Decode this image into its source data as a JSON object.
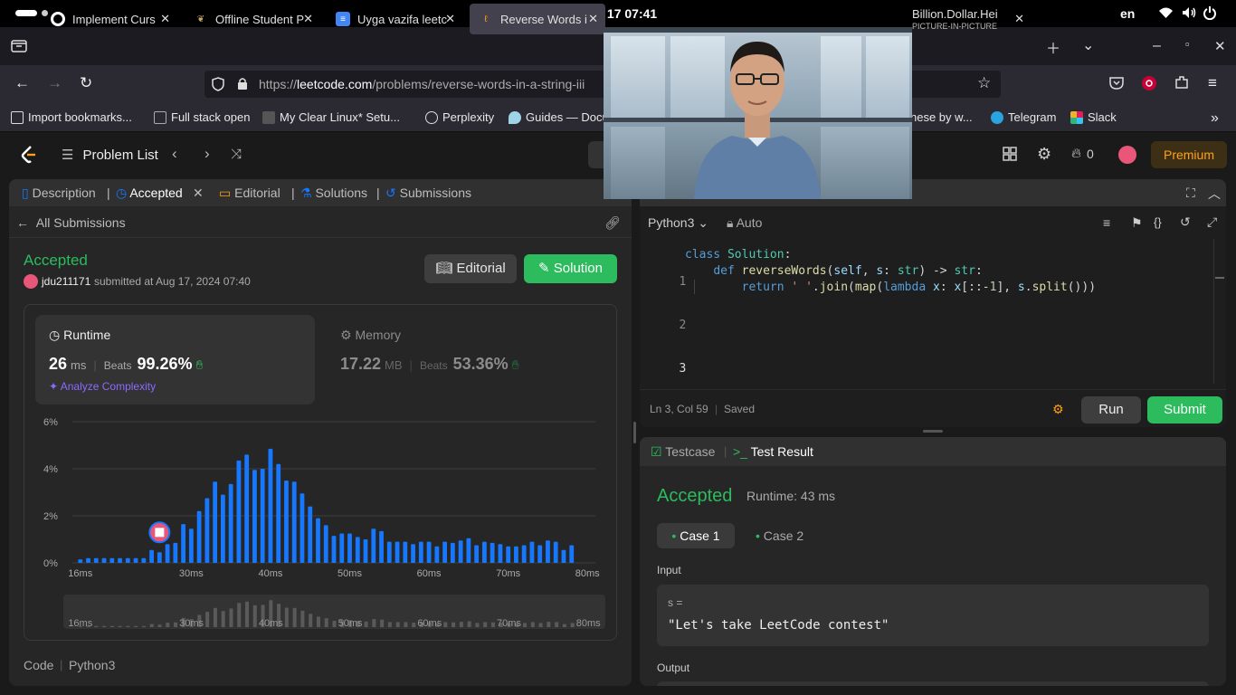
{
  "system": {
    "clock": "Aug 17  07:41",
    "lang": "en"
  },
  "browser": {
    "tabs": [
      {
        "title": "Implement Curs",
        "icon": "github-icon"
      },
      {
        "title": "Offline Student P",
        "icon": "bird-icon"
      },
      {
        "title": "Uyga vazifa leetc",
        "icon": "docs-icon"
      },
      {
        "title": "Reverse Words i",
        "icon": "leetcode-icon",
        "active": true
      },
      {
        "title": "Billion.Dollar.Hei",
        "subtitle": "PICTURE-IN-PICTURE",
        "icon": "pip-icon"
      }
    ],
    "url_prefix": "https://",
    "url_domain": "leetcode.com",
    "url_path": "/problems/reverse-words-in-a-string-iii",
    "bookmarks": [
      {
        "label": "Import bookmarks...",
        "icon": "import-icon"
      },
      {
        "label": "Full stack open",
        "icon": "page-icon"
      },
      {
        "label": "My Clear Linux* Setu...",
        "icon": "linux-icon"
      },
      {
        "label": "Perplexity",
        "icon": "globe-icon"
      },
      {
        "label": "Guides — Docu",
        "icon": "drop-icon"
      },
      {
        "label": "hese by w...",
        "icon": "page-icon"
      },
      {
        "label": "Telegram",
        "icon": "telegram-icon"
      },
      {
        "label": "Slack",
        "icon": "slack-icon"
      }
    ]
  },
  "leetcode": {
    "problem_list": "Problem List",
    "streak": "0",
    "premium": "Premium"
  },
  "left_panel": {
    "tabs": {
      "description": "Description",
      "accepted": "Accepted",
      "editorial": "Editorial",
      "solutions": "Solutions",
      "submissions": "Submissions"
    },
    "back_label": "All Submissions",
    "status": "Accepted",
    "user": "jdu211171",
    "submitted": "submitted at Aug 17, 2024 07:40",
    "editorial_btn": "Editorial",
    "solution_btn": "Solution",
    "runtime": {
      "label": "Runtime",
      "value": "26",
      "unit": "ms",
      "beats_label": "Beats",
      "beats": "99.26%",
      "analyze": "Analyze Complexity"
    },
    "memory": {
      "label": "Memory",
      "value": "17.22",
      "unit": "MB",
      "beats_label": "Beats",
      "beats": "53.36%"
    },
    "code_label": "Code",
    "code_lang": "Python3"
  },
  "chart_data": {
    "type": "bar",
    "title": "",
    "xlabel": "",
    "ylabel": "",
    "y_ticks": [
      "6%",
      "4%",
      "2%",
      "0%"
    ],
    "ylim": [
      0,
      6
    ],
    "x_ticks": [
      "16ms",
      "30ms",
      "40ms",
      "50ms",
      "60ms",
      "70ms",
      "80ms"
    ],
    "x_tick_values": [
      16,
      30,
      40,
      50,
      60,
      70,
      80
    ],
    "xlim": [
      15,
      81
    ],
    "x": [
      16,
      17,
      18,
      19,
      20,
      21,
      22,
      23,
      24,
      25,
      26,
      27,
      28,
      29,
      30,
      31,
      32,
      33,
      34,
      35,
      36,
      37,
      38,
      39,
      40,
      41,
      42,
      43,
      44,
      45,
      46,
      47,
      48,
      49,
      50,
      51,
      52,
      53,
      54,
      55,
      56,
      57,
      58,
      59,
      60,
      61,
      62,
      63,
      64,
      65,
      66,
      67,
      68,
      69,
      70,
      71,
      72,
      73,
      74,
      75,
      76,
      77,
      78,
      79,
      80
    ],
    "values": [
      0.15,
      0.2,
      0.2,
      0.2,
      0.2,
      0.2,
      0.2,
      0.2,
      0.2,
      0.55,
      0.45,
      0.8,
      0.85,
      1.65,
      1.45,
      2.2,
      2.75,
      3.45,
      2.9,
      3.35,
      4.35,
      4.6,
      3.95,
      4.0,
      4.85,
      4.2,
      3.5,
      3.45,
      2.95,
      2.4,
      1.9,
      1.6,
      1.15,
      1.25,
      1.25,
      1.1,
      1.0,
      1.45,
      1.35,
      0.9,
      0.9,
      0.9,
      0.8,
      0.9,
      0.9,
      0.7,
      0.9,
      0.85,
      0.95,
      1.05,
      0.75,
      0.9,
      0.85,
      0.8,
      0.7,
      0.7,
      0.75,
      0.9,
      0.75,
      0.95,
      0.9,
      0.55,
      0.75
    ],
    "user_marker_x": 26,
    "bar_color": "#1677ff",
    "grid": true
  },
  "editor": {
    "language": "Python3",
    "mode": "Auto",
    "line_numbers": [
      "1",
      "2",
      "3"
    ],
    "status_pos": "Ln 3, Col 59",
    "status_saved": "Saved",
    "run": "Run",
    "submit": "Submit"
  },
  "result": {
    "tab_testcase": "Testcase",
    "tab_result": "Test Result",
    "status": "Accepted",
    "runtime": "Runtime: 43 ms",
    "cases": [
      "Case 1",
      "Case 2"
    ],
    "input_label": "Input",
    "var_label": "s =",
    "input_value": "\"Let's take LeetCode contest\"",
    "output_label": "Output"
  },
  "colors": {
    "accent_green": "#2cbb5d",
    "premium_orange": "#ffa116",
    "bar_blue": "#1677ff"
  }
}
